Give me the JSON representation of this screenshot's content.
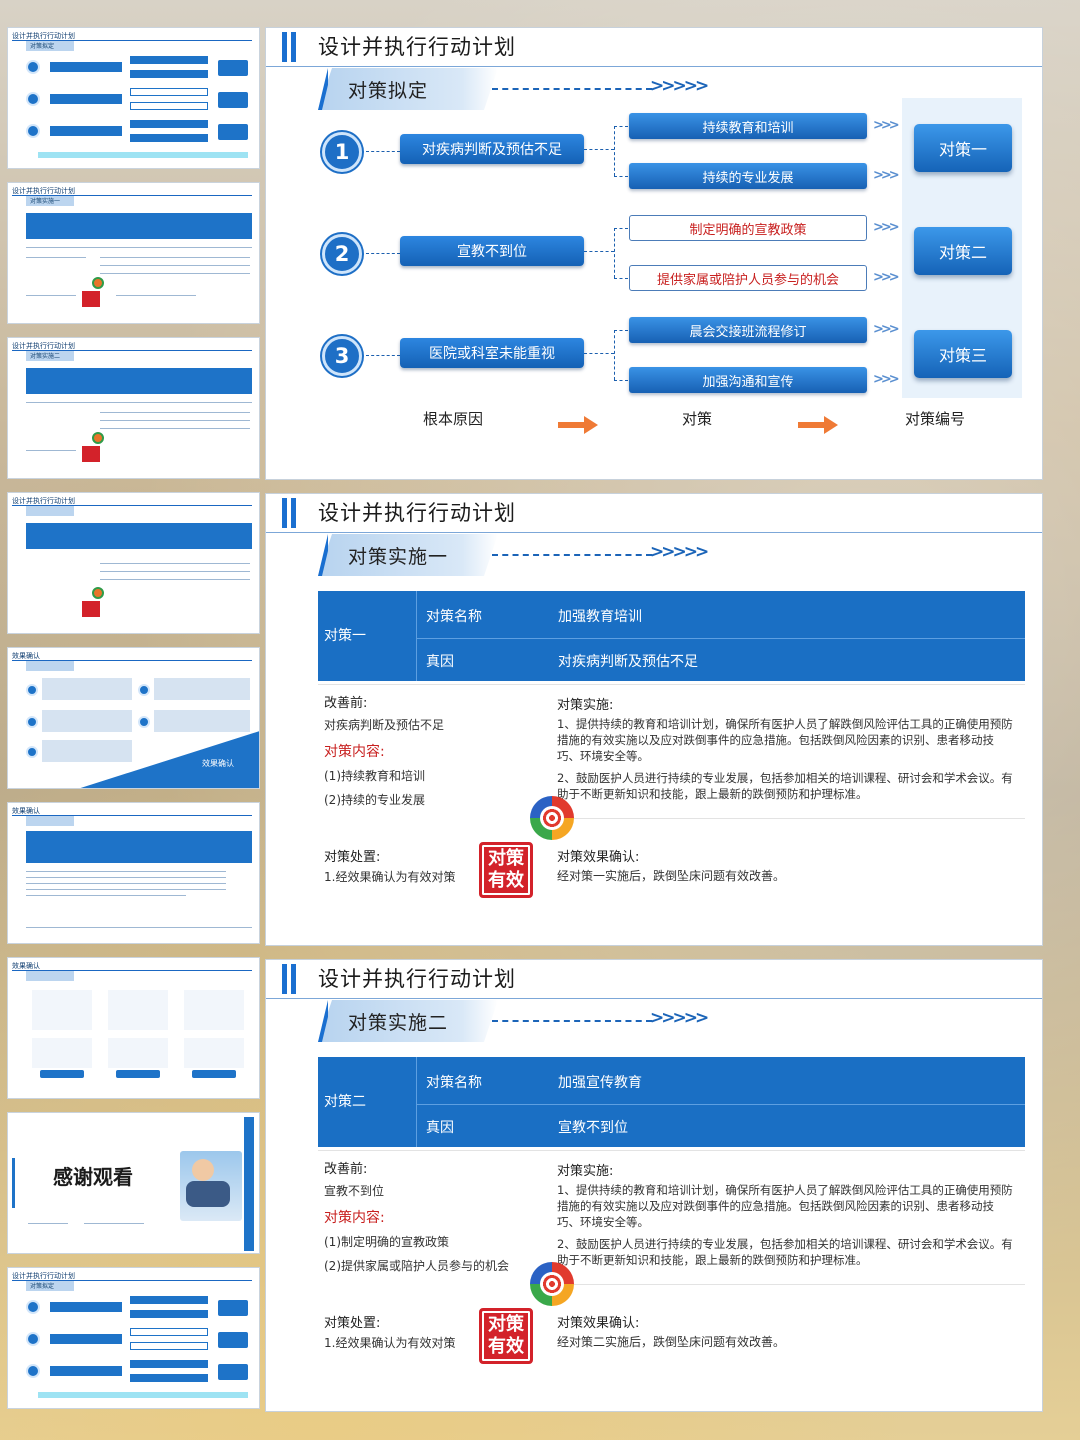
{
  "slide1": {
    "title": "设计并执行行动计划",
    "subtitle": "对策拟定",
    "causes": [
      {
        "num": "1",
        "label": "对疾病判断及预估不足"
      },
      {
        "num": "2",
        "label": "宣教不到位"
      },
      {
        "num": "3",
        "label": "医院或科室未能重视"
      }
    ],
    "measures": [
      "持续教育和培训",
      "持续的专业发展",
      "制定明确的宣教政策",
      "提供家属或陪护人员参与的机会",
      "晨会交接班流程修订",
      "加强沟通和宣传"
    ],
    "codes": [
      "对策一",
      "对策二",
      "对策三"
    ],
    "footer": [
      "根本原因",
      "对策",
      "对策编号"
    ],
    "chevrons": ">>>>>",
    "mini_chevron": ">>>"
  },
  "slide2": {
    "title": "设计并执行行动计划",
    "subtitle": "对策实施一",
    "table": {
      "row_label": "对策一",
      "k1": "对策名称",
      "v1": "加强教育培训",
      "k2": "真因",
      "v2": "对疾病判断及预估不足"
    },
    "before_label": "改善前:",
    "before_text": "对疾病判断及预估不足",
    "content_label": "对策内容:",
    "content_items": [
      "(1)持续教育和培训",
      "(2)持续的专业发展"
    ],
    "impl_label": "对策实施:",
    "impl_1": "1、提供持续的教育和培训计划，确保所有医护人员了解跌倒风险评估工具的正确使用预防措施的有效实施以及应对跌倒事件的应急措施。包括跌倒风险因素的识别、患者移动技巧、环境安全等。",
    "impl_2": "2、鼓励医护人员进行持续的专业发展，包括参加相关的培训课程、研讨会和学术会议。有助于不断更新知识和技能，跟上最新的跌倒预防和护理标准。",
    "disposal_label": "对策处置:",
    "disposal_text": "1.经效果确认为有效对策",
    "stamp": "对策有效",
    "confirm_label": "对策效果确认:",
    "confirm_text": "经对策一实施后，跌倒坠床问题有效改善。"
  },
  "slide3": {
    "title": "设计并执行行动计划",
    "subtitle": "对策实施二",
    "table": {
      "row_label": "对策二",
      "k1": "对策名称",
      "v1": "加强宣传教育",
      "k2": "真因",
      "v2": "宣教不到位"
    },
    "before_label": "改善前:",
    "before_text": "宣教不到位",
    "content_label": "对策内容:",
    "content_items": [
      "(1)制定明确的宣教政策",
      "(2)提供家属或陪护人员参与的机会"
    ],
    "impl_label": "对策实施:",
    "impl_1": "1、提供持续的教育和培训计划，确保所有医护人员了解跌倒风险评估工具的正确使用预防措施的有效实施以及应对跌倒事件的应急措施。包括跌倒风险因素的识别、患者移动技巧、环境安全等。",
    "impl_2": "2、鼓励医护人员进行持续的专业发展，包括参加相关的培训课程、研讨会和学术会议。有助于不断更新知识和技能，跟上最新的跌倒预防和护理标准。",
    "disposal_label": "对策处置:",
    "disposal_text": "1.经效果确认为有效对策",
    "stamp": "对策有效",
    "confirm_label": "对策效果确认:",
    "confirm_text": "经对策二实施后，跌倒坠床问题有效改善。"
  },
  "thumbs": {
    "head": "设计并执行行动计划",
    "effect_head": "效果确认",
    "effect_button": "效果确认",
    "thanks": "感谢观看",
    "stamp": "对策有效"
  },
  "colors": {
    "accent": "#1a6fc4",
    "red": "#c8201f",
    "cyan": "#7fd8ef"
  }
}
